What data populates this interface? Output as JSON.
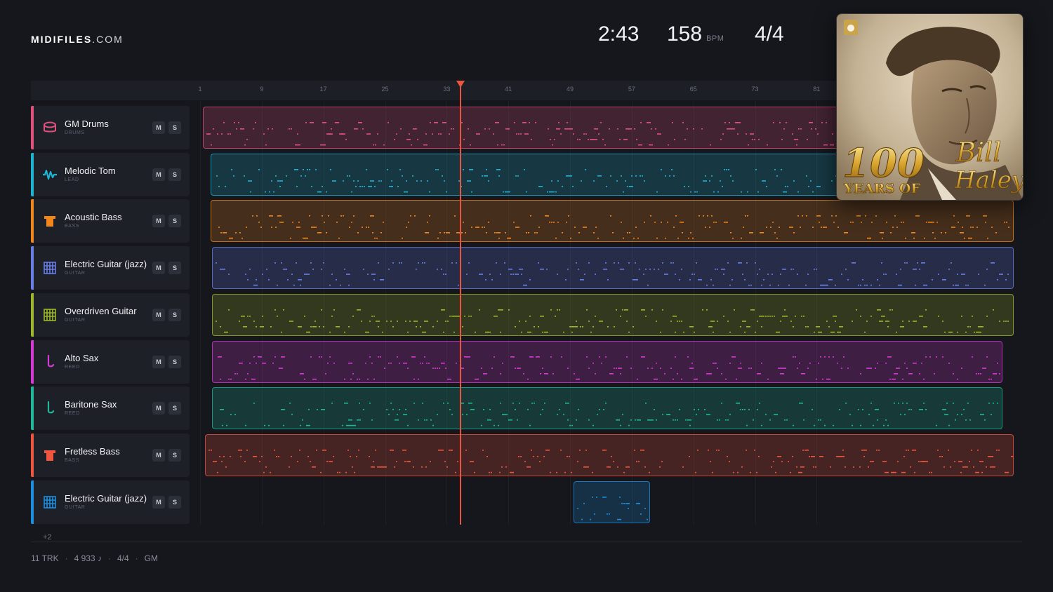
{
  "brand": {
    "name": "MIDIFILES",
    "domain": ".COM"
  },
  "transport": {
    "time": "2:43",
    "tempo": "158",
    "tempo_unit": "BPM",
    "time_signature": "4/4"
  },
  "album": {
    "title_line1": "100",
    "title_line2": "YEARS OF",
    "artist_line1": "Bill",
    "artist_line2": "Haley"
  },
  "ruler": {
    "ticks": [
      "1",
      "9",
      "17",
      "25",
      "33",
      "41",
      "49",
      "57",
      "65",
      "73",
      "81"
    ]
  },
  "playhead": {
    "bar": 33.6
  },
  "tracks": [
    {
      "name": "GM Drums",
      "type": "DRUMS",
      "color": "#e0517e",
      "icon": "drum-icon",
      "mute": "M",
      "solo": "S"
    },
    {
      "name": "Melodic Tom",
      "type": "LEAD",
      "color": "#1fb3d2",
      "icon": "waveform-icon",
      "mute": "M",
      "solo": "S"
    },
    {
      "name": "Acoustic Bass",
      "type": "BASS",
      "color": "#f0861c",
      "icon": "bass-icon",
      "mute": "M",
      "solo": "S"
    },
    {
      "name": "Electric Guitar (jazz)",
      "type": "GUITAR",
      "color": "#6a7ee8",
      "icon": "guitar-icon",
      "mute": "M",
      "solo": "S"
    },
    {
      "name": "Overdriven Guitar",
      "type": "GUITAR",
      "color": "#9db82a",
      "icon": "guitar-icon",
      "mute": "M",
      "solo": "S"
    },
    {
      "name": "Alto Sax",
      "type": "REED",
      "color": "#d63ad6",
      "icon": "sax-icon",
      "mute": "M",
      "solo": "S"
    },
    {
      "name": "Baritone Sax",
      "type": "REED",
      "color": "#1fb899",
      "icon": "sax-icon",
      "mute": "M",
      "solo": "S"
    },
    {
      "name": "Fretless Bass",
      "type": "BASS",
      "color": "#f0553f",
      "icon": "bass-icon",
      "mute": "M",
      "solo": "S"
    },
    {
      "name": "Electric Guitar (jazz)",
      "type": "GUITAR",
      "color": "#1c8fe0",
      "icon": "guitar-icon",
      "mute": "M",
      "solo": "S"
    }
  ],
  "more_tracks": "+2",
  "footer": {
    "tracks": "11 TRK",
    "notes": "4 933 ♪",
    "meter": "4/4",
    "standard": "GM"
  }
}
